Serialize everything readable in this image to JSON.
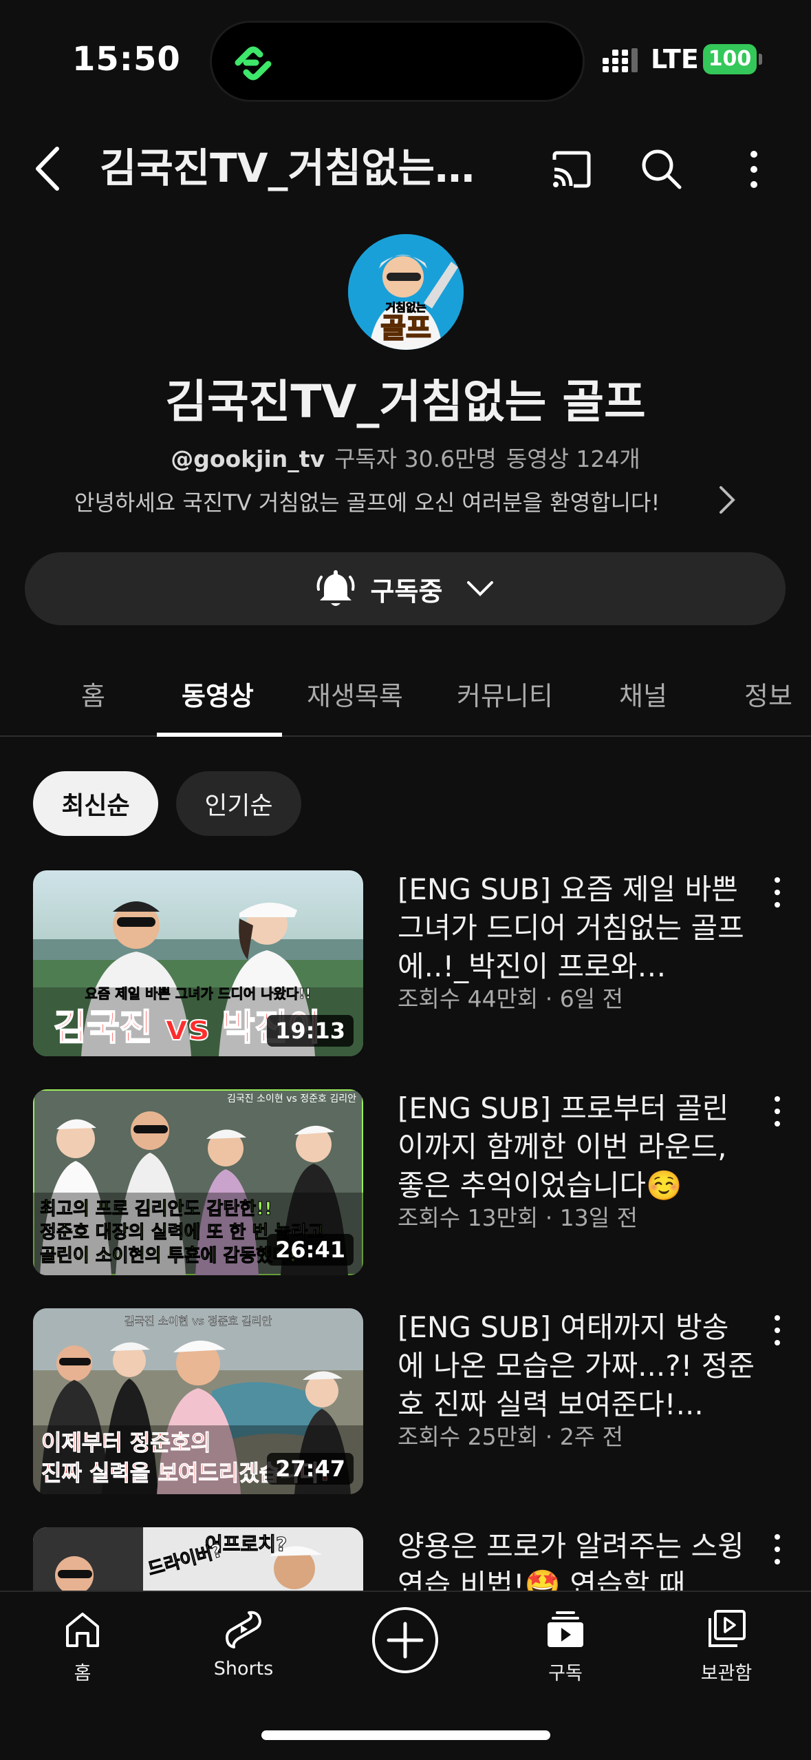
{
  "status_bar": {
    "time": "15:50",
    "network": "LTE",
    "battery": "100"
  },
  "header": {
    "title": "김국진TV_거침없는…"
  },
  "channel": {
    "avatar_text": "거침없는 골프",
    "name": "김국진TV_거침없는 골프",
    "handle": "@gookjin_tv",
    "subscribers": "구독자 30.6만명",
    "video_count": "동영상 124개",
    "description": "안녕하세요 국진TV 거침없는 골프에 오신 여러분을 환영합니다!"
  },
  "subscribe_button": {
    "label": "구독중"
  },
  "tabs": [
    {
      "label": "홈"
    },
    {
      "label": "동영상"
    },
    {
      "label": "재생목록"
    },
    {
      "label": "커뮤니티"
    },
    {
      "label": "채널"
    },
    {
      "label": "정보"
    }
  ],
  "chips": [
    {
      "label": "최신순"
    },
    {
      "label": "인기순"
    }
  ],
  "videos": [
    {
      "title": "[ENG SUB] 요즘 제일 바쁜 그녀가 드디어 거침없는 골프에..!_박진이 프로와…",
      "meta": "조회수 44만회 · 6일 전",
      "duration": "19:13",
      "thumb_caption_top": "요즘 제일 바쁜 그녀가 드디어 나왔다!!",
      "thumb_caption_main": "김국진 vs 박진이"
    },
    {
      "title": "[ENG SUB] 프로부터 골린이까지 함께한 이번 라운드, 좋은 추억이었습니다☺️",
      "meta": "조회수 13만회 · 13일 전",
      "duration": "26:41",
      "thumb_caption_top": "김국진 소이현 vs 정준호 김리안",
      "thumb_caption_l1": "최고의 프로 김리안도 감탄한!!",
      "thumb_caption_l2": "정준호 대장의 실력에 또 한 번 놀라고",
      "thumb_caption_l3": "골린이 소이현의 투혼에 감동했다!"
    },
    {
      "title": "[ENG SUB] 여태까지 방송에 나온 모습은 가짜...?! 정준호 진짜 실력 보여준다!...",
      "meta": "조회수 25만회 · 2주 전",
      "duration": "27:47",
      "thumb_caption_top": "김국진 소이현 vs 정준호 김리안",
      "thumb_caption_l1": "이제부터 정준호의",
      "thumb_caption_l2": "진짜 실력을 보여드리겠습니다!"
    },
    {
      "title": "양용은 프로가 알려주는 스윙 연습 비법!🤩 연습할 때",
      "meta": "",
      "thumb_caption_top": "어프로치?",
      "thumb_caption_l1": "드라이버?"
    }
  ],
  "bottom_nav": [
    {
      "label": "홈",
      "icon": "home-icon"
    },
    {
      "label": "Shorts",
      "icon": "shorts-icon"
    },
    {
      "label": "",
      "icon": "create-icon"
    },
    {
      "label": "구독",
      "icon": "subscriptions-icon"
    },
    {
      "label": "보관함",
      "icon": "library-icon"
    }
  ],
  "colors": {
    "background": "#0f0f0f",
    "battery": "#34c759",
    "chip_selected": "#f1f1f1",
    "thumb_red": "#e8272b",
    "thumb_green": "#9df05a"
  }
}
